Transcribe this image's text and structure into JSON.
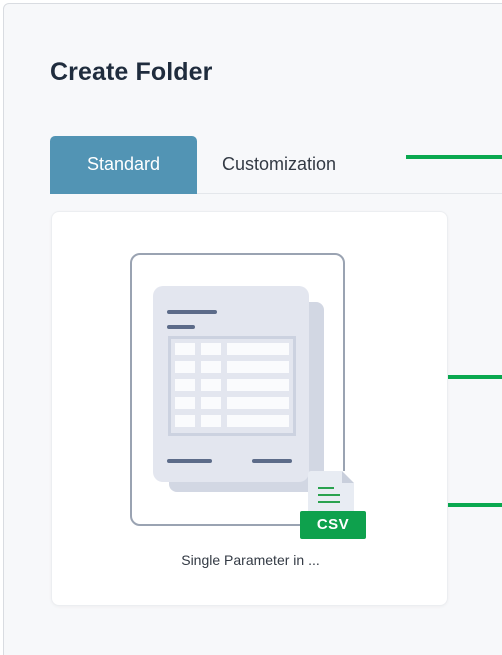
{
  "dialog": {
    "title": "Create Folder"
  },
  "tabs": [
    {
      "label": "Standard",
      "active": true
    },
    {
      "label": "Customization",
      "active": false
    }
  ],
  "templates": [
    {
      "label": "Single Parameter in ...",
      "badge": "CSV",
      "icon": "spreadsheet-document-icon"
    }
  ],
  "colors": {
    "active_tab": "#5294b4",
    "annotation": "#0aa84f",
    "csv_badge": "#0ea14d",
    "title_text": "#1f2c3d"
  }
}
